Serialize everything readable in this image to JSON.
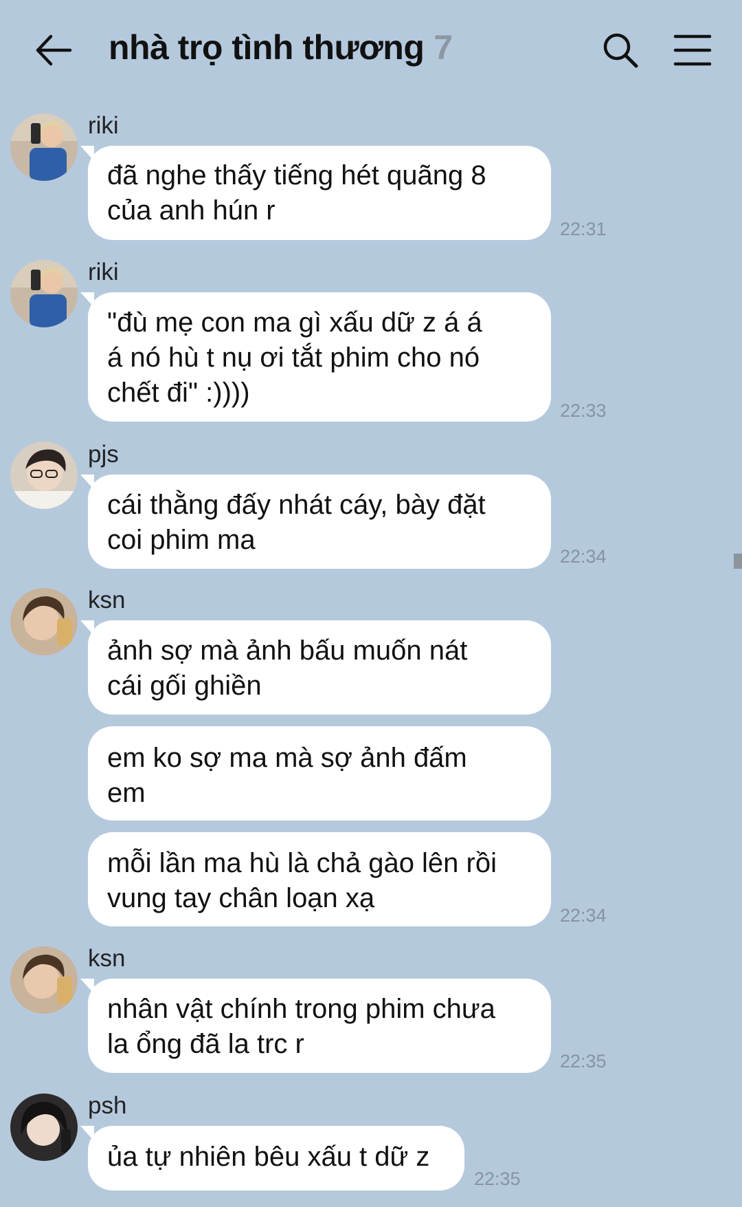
{
  "header": {
    "back_icon": "arrow-left-icon",
    "title": "nhà trọ tình thương",
    "member_count": "7",
    "search_icon": "search-icon",
    "menu_icon": "hamburger-menu-icon"
  },
  "colors": {
    "background": "#b5c9dd",
    "bubble": "#ffffff",
    "timestamp": "#8793a1",
    "member_count": "#8c97a3"
  },
  "messages": [
    {
      "sender": "riki",
      "text": "đã nghe thấy tiếng hét quãng 8\ncủa anh hún r",
      "time": "22:31"
    },
    {
      "sender": "riki",
      "text": "\"đù mẹ con ma gì xấu dữ z á á\ná nó hù t nụ ơi tắt phim cho nó\nchết đi\" :))))",
      "time": "22:33"
    },
    {
      "sender": "pjs",
      "text": "cái thằng đấy nhát cáy, bày đặt\ncoi phim ma",
      "time": "22:34"
    },
    {
      "sender": "ksn",
      "text": "ảnh sợ mà ảnh bấu muốn nát\ncái gối ghiền"
    },
    {
      "text": "em ko sợ ma mà sợ ảnh đấm\nem"
    },
    {
      "text": "mỗi lần ma hù là chả gào lên rồi\nvung tay chân loạn xạ",
      "time": "22:34"
    },
    {
      "sender": "ksn",
      "text": "nhân vật chính trong phim chưa\nla ổng đã la trc r",
      "time": "22:35"
    },
    {
      "sender": "psh",
      "text": "ủa tự nhiên bêu xấu t dữ z",
      "time": "22:35"
    }
  ]
}
